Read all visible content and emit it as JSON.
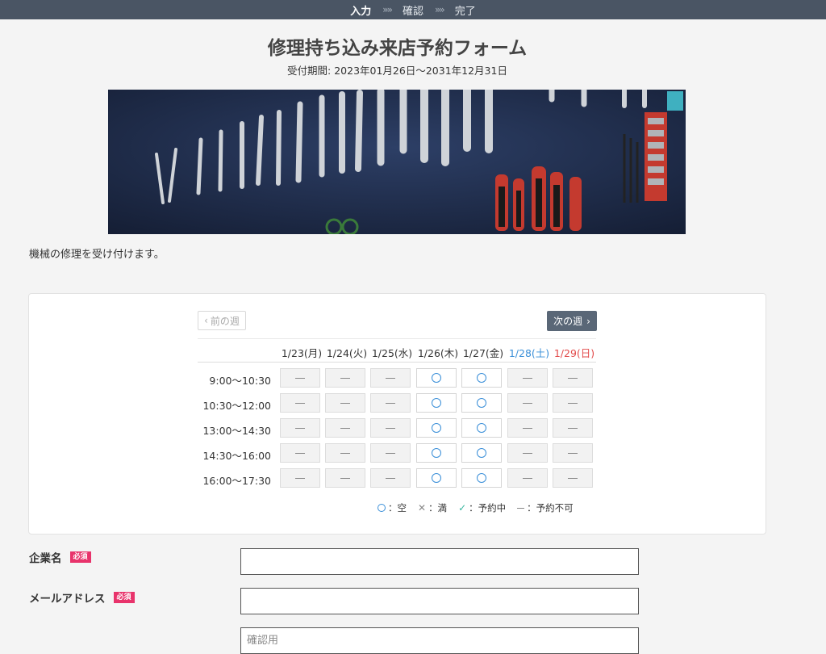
{
  "steps": [
    "入力",
    "確認",
    "完了"
  ],
  "steps_separator": "»»",
  "form": {
    "title": "修理持ち込み来店予約フォーム",
    "period": "受付期間: 2023年01月26日～2031年12月31日",
    "description": "機械の修理を受け付けます。"
  },
  "calendar": {
    "prev_label": "前の週",
    "next_label": "次の週",
    "days": [
      "1/23(月)",
      "1/24(火)",
      "1/25(水)",
      "1/26(木)",
      "1/27(金)",
      "1/28(土)",
      "1/29(日)"
    ],
    "times": [
      "9:00～10:30",
      "10:30～12:00",
      "13:00～14:30",
      "14:30～16:00",
      "16:00～17:30"
    ],
    "availability": [
      [
        "unavailable",
        "unavailable",
        "unavailable",
        "open",
        "open",
        "unavailable",
        "unavailable"
      ],
      [
        "unavailable",
        "unavailable",
        "unavailable",
        "open",
        "open",
        "unavailable",
        "unavailable"
      ],
      [
        "unavailable",
        "unavailable",
        "unavailable",
        "open",
        "open",
        "unavailable",
        "unavailable"
      ],
      [
        "unavailable",
        "unavailable",
        "unavailable",
        "open",
        "open",
        "unavailable",
        "unavailable"
      ],
      [
        "unavailable",
        "unavailable",
        "unavailable",
        "open",
        "open",
        "unavailable",
        "unavailable"
      ]
    ],
    "legend": {
      "open": "：空",
      "full": "：満",
      "reserved": "：予約中",
      "unavailable": "：予約不可"
    }
  },
  "fields": {
    "company_label": "企業名",
    "email_label": "メールアドレス",
    "required_badge": "必須",
    "company_value": "",
    "email_value": "",
    "email_confirm_placeholder": "確認用"
  },
  "colors": {
    "accent": "#3a8fd8",
    "saturday": "#3a8fd8",
    "sunday": "#e24a4a",
    "required": "#e8336b",
    "step_bar": "#4a5564",
    "next_button": "#5a6777"
  }
}
